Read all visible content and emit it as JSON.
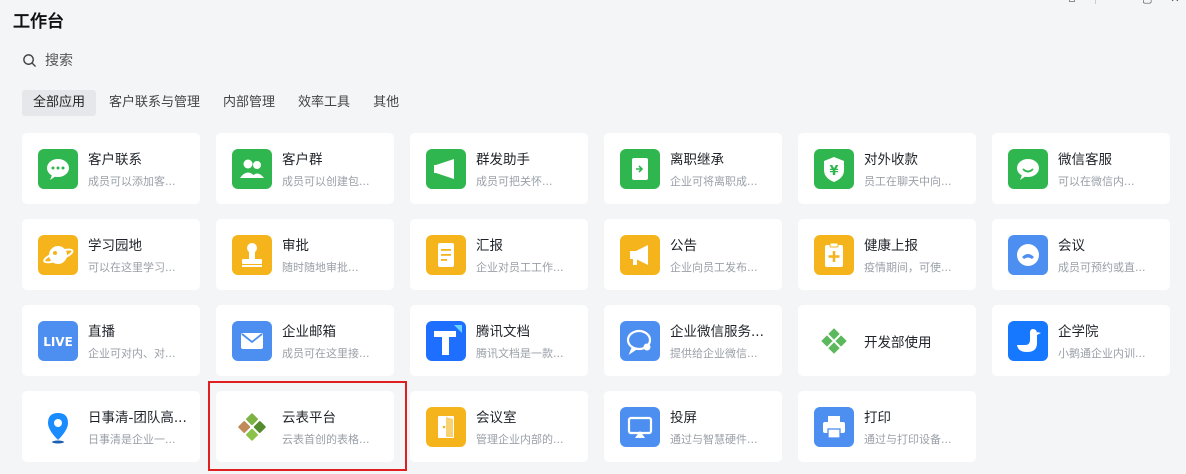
{
  "header": {
    "title": "工作台"
  },
  "search": {
    "placeholder": "搜索"
  },
  "tabs": [
    {
      "label": "全部应用",
      "active": true
    },
    {
      "label": "客户联系与管理"
    },
    {
      "label": "内部管理"
    },
    {
      "label": "效率工具"
    },
    {
      "label": "其他"
    }
  ],
  "apps": [
    {
      "name": "客户联系",
      "desc": "成员可以添加客...",
      "icon": "chat-bubble-icon",
      "color": "#2fb64f"
    },
    {
      "name": "客户群",
      "desc": "成员可以创建包...",
      "icon": "group-icon",
      "color": "#2fb64f"
    },
    {
      "name": "群发助手",
      "desc": "成员可把关怀...",
      "icon": "megaphone-icon",
      "color": "#2fb64f"
    },
    {
      "name": "离职继承",
      "desc": "企业可将离职成...",
      "icon": "transfer-doc-icon",
      "color": "#2fb64f"
    },
    {
      "name": "对外收款",
      "desc": "员工在聊天中向...",
      "icon": "yuan-shield-icon",
      "color": "#2fb64f"
    },
    {
      "name": "微信客服",
      "desc": "可以在微信内...",
      "icon": "wechat-service-icon",
      "color": "#2fb64f"
    },
    {
      "name": "学习园地",
      "desc": "可以在这里学习...",
      "icon": "planet-icon",
      "color": "#f5b41b"
    },
    {
      "name": "审批",
      "desc": "随时随地审批...",
      "icon": "stamp-icon",
      "color": "#f5b41b"
    },
    {
      "name": "汇报",
      "desc": "企业对员工工作...",
      "icon": "report-icon",
      "color": "#f5b41b"
    },
    {
      "name": "公告",
      "desc": "企业向员工发布...",
      "icon": "announcement-icon",
      "color": "#f5b41b"
    },
    {
      "name": "健康上报",
      "desc": "疫情期间，可使...",
      "icon": "health-plus-icon",
      "color": "#f5b41b"
    },
    {
      "name": "会议",
      "desc": "成员可预约或直...",
      "icon": "meeting-phone-icon",
      "color": "#4d8ff0"
    },
    {
      "name": "直播",
      "desc": "企业可对内、对...",
      "icon": "live-icon",
      "color": "#4d8ff0",
      "badge": "LIVE"
    },
    {
      "name": "企业邮箱",
      "desc": "成员可在这里接...",
      "icon": "mail-icon",
      "color": "#4d8ff0"
    },
    {
      "name": "腾讯文档",
      "desc": "腾讯文档是一款...",
      "icon": "tencent-docs-icon",
      "color": "#1e6fff"
    },
    {
      "name": "企业微信服务...",
      "desc": "提供给企业微信...",
      "icon": "service-chat-icon",
      "color": "#4d8ff0"
    },
    {
      "name": "开发部使用",
      "desc": "",
      "icon": "diamond-logo-icon",
      "color": "#5cb85c"
    },
    {
      "name": "企学院",
      "desc": "小鹅通企业内训...",
      "icon": "goose-icon",
      "color": "#1677ff"
    },
    {
      "name": "日事清-团队高...",
      "desc": "日事清是企业一...",
      "icon": "location-pin-icon",
      "color": "#1a8cff"
    },
    {
      "name": "云表平台",
      "desc": "云表首创的表格...",
      "icon": "yunbiao-logo-icon",
      "color": "#6aa84f"
    },
    {
      "name": "会议室",
      "desc": "管理企业内部的...",
      "icon": "door-icon",
      "color": "#f5b41b"
    },
    {
      "name": "投屏",
      "desc": "通过与智慧硬件...",
      "icon": "screen-cast-icon",
      "color": "#4d8ff0"
    },
    {
      "name": "打印",
      "desc": "通过与打印设备...",
      "icon": "printer-icon",
      "color": "#4d8ff0"
    }
  ]
}
